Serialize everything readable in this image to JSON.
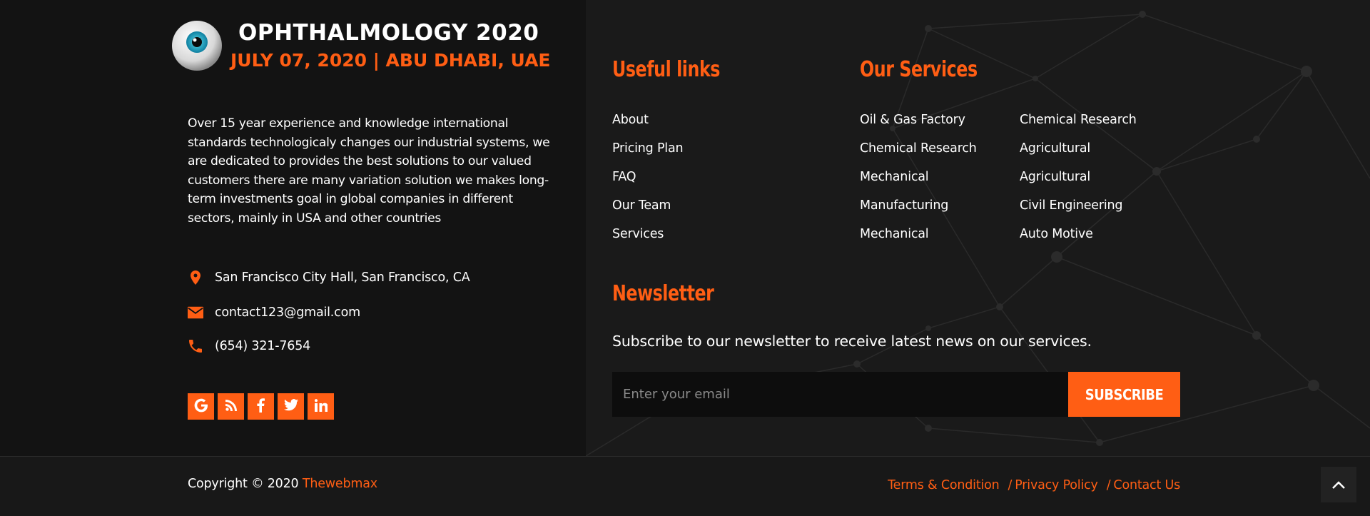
{
  "brand": {
    "title": "OPHTHALMOLOGY 2020",
    "subtitle": "JULY 07,  2020 | ABU DHABI, UAE",
    "logo_icon": "eye-logo"
  },
  "about": {
    "text": "Over 15 year experience and knowledge international standards technologicaly changes our industrial systems, we are dedicated to provides the best solutions to our valued customers there are many variation solution we makes long-term investments goal in global companies in different sectors, mainly in USA and other countries"
  },
  "contact": {
    "address": "San Francisco City Hall, San Francisco, CA",
    "email": "contact123@gmail.com",
    "phone": "(654) 321-7654"
  },
  "social": [
    {
      "icon": "google-icon"
    },
    {
      "icon": "rss-icon"
    },
    {
      "icon": "facebook-icon"
    },
    {
      "icon": "twitter-icon"
    },
    {
      "icon": "linkedin-icon"
    }
  ],
  "useful_links": {
    "heading": "Useful links",
    "items": [
      "About",
      "Pricing Plan",
      "FAQ",
      "Our Team",
      "Services"
    ]
  },
  "services": {
    "heading": "Our Services",
    "col1": [
      "Oil & Gas Factory",
      "Chemical Research",
      "Mechanical",
      "Manufacturing",
      "Mechanical"
    ],
    "col2": [
      "Chemical Research",
      "Agricultural",
      "Agricultural",
      "Civil Engineering",
      "Auto Motive"
    ]
  },
  "newsletter": {
    "heading": "Newsletter",
    "text": "Subscribe to our newsletter to receive latest news on our services.",
    "placeholder": "Enter your email",
    "button": "SUBSCRIBE"
  },
  "footer": {
    "copyright": "Copyright © 2020",
    "brand_link": "Thewebmax",
    "links": [
      "Terms & Condition",
      "Privacy Policy",
      "Contact Us"
    ],
    "separator": "/"
  },
  "colors": {
    "accent": "#ff5e14",
    "background": "#181818",
    "panel_dark": "#131313"
  }
}
